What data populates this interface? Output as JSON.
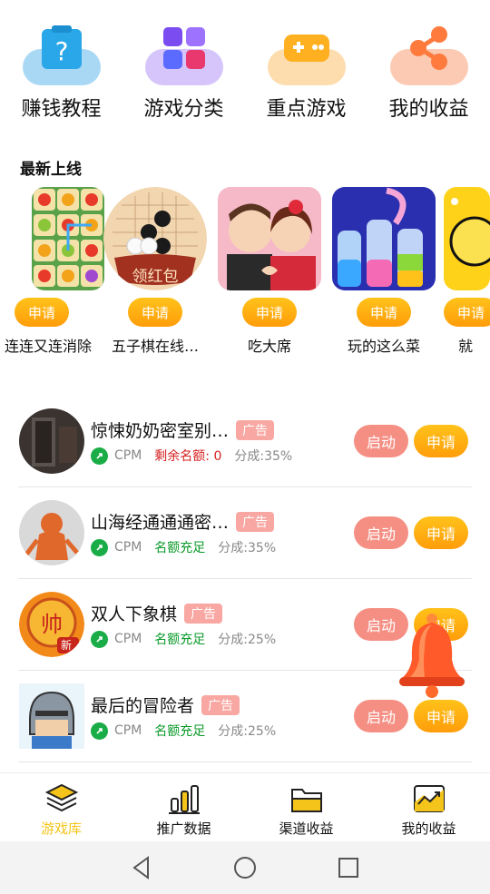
{
  "top_grid": [
    {
      "label": "赚钱教程",
      "icon": "question-box-icon",
      "color": "#2aa7e8"
    },
    {
      "label": "游戏分类",
      "icon": "grid-icon",
      "color": "#7b4cf0"
    },
    {
      "label": "重点游戏",
      "icon": "gamepad-icon",
      "color": "#ffb020"
    },
    {
      "label": "我的收益",
      "icon": "share-icon",
      "color": "#ff7a3d"
    }
  ],
  "section_title": "最新上线",
  "carousel": [
    {
      "name": "连连又连消除",
      "button": "申请",
      "thumb": "fruit-tiles-thumb"
    },
    {
      "name": "五子棋在线…",
      "button": "申请",
      "thumb": "gomoku-thumb",
      "thumb_text": "领红包"
    },
    {
      "name": "吃大席",
      "button": "申请",
      "thumb": "couple-thumb"
    },
    {
      "name": "玩的这么菜",
      "button": "申请",
      "thumb": "bottles-thumb"
    },
    {
      "name": "就",
      "button": "申请",
      "thumb": "yellow-thumb"
    }
  ],
  "list": [
    {
      "title": "惊悚奶奶密室别…",
      "badge": "广告",
      "cpm": "CPM",
      "quota": "剩余名额: 0",
      "quota_status": "red",
      "share": "分成:35%",
      "start": "启动",
      "apply": "申请",
      "avatar": "dark-room-avatar"
    },
    {
      "title": "山海经通通通密…",
      "badge": "广告",
      "cpm": "CPM",
      "quota": "名额充足",
      "quota_status": "green",
      "share": "分成:35%",
      "start": "启动",
      "apply": "申请",
      "avatar": "monster-avatar"
    },
    {
      "title": "双人下象棋",
      "badge": "广告",
      "cpm": "CPM",
      "quota": "名额充足",
      "quota_status": "green",
      "share": "分成:25%",
      "start": "启动",
      "apply": "申请",
      "avatar": "chess-avatar",
      "avatar_text": "新"
    },
    {
      "title": "最后的冒险者",
      "badge": "广告",
      "cpm": "CPM",
      "quota": "名额充足",
      "quota_status": "green",
      "share": "分成:25%",
      "start": "启动",
      "apply": "申请",
      "avatar": "knight-avatar"
    }
  ],
  "tabs": [
    {
      "label": "游戏库",
      "icon": "layers-icon",
      "active": true
    },
    {
      "label": "推广数据",
      "icon": "bar-chart-icon",
      "active": false
    },
    {
      "label": "渠道收益",
      "icon": "folder-icon",
      "active": false
    },
    {
      "label": "我的收益",
      "icon": "trend-icon",
      "active": false
    }
  ],
  "colors": {
    "accent": "#f4c41a",
    "apply_btn": "#ffb010",
    "start_btn": "#f58f84",
    "badge": "#f8a7a2"
  }
}
